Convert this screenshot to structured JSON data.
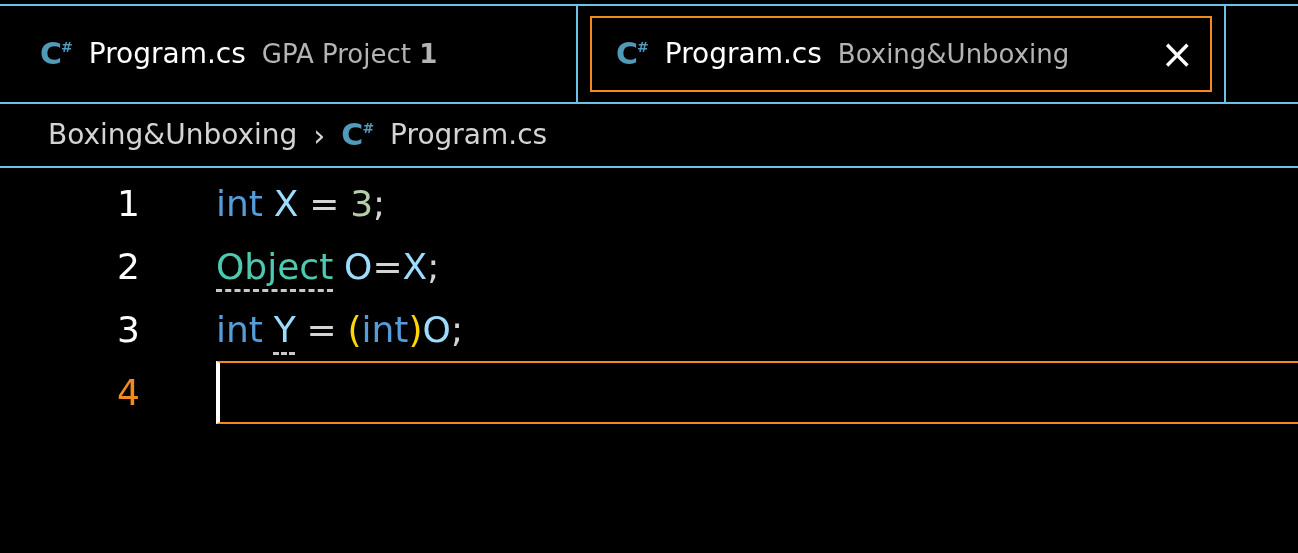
{
  "tabs": [
    {
      "icon": "C#",
      "file": "Program.cs",
      "project": "GPA Project **1**",
      "selected": false
    },
    {
      "icon": "C#",
      "file": "Program.cs",
      "project": "Boxing&Unboxing",
      "selected": true,
      "close": "×"
    }
  ],
  "breadcrumb": {
    "project": "Boxing&Unboxing",
    "separator": "›",
    "icon": "C#",
    "file": "Program.cs"
  },
  "lines": [
    {
      "number": "1",
      "current": false,
      "tokens": [
        {
          "text": "int",
          "kind": "keyword",
          "hint": false,
          "space_before": false
        },
        {
          "text": "X",
          "kind": "ident",
          "hint": false,
          "space_before": true
        },
        {
          "text": "=",
          "kind": "op",
          "hint": false,
          "space_before": true
        },
        {
          "text": "3",
          "kind": "number",
          "hint": false,
          "space_before": true
        },
        {
          "text": ";",
          "kind": "op",
          "hint": false,
          "space_before": false
        }
      ]
    },
    {
      "number": "2",
      "current": false,
      "tokens": [
        {
          "text": "Object",
          "kind": "type",
          "hint": true,
          "space_before": false
        },
        {
          "text": "O",
          "kind": "ident",
          "hint": false,
          "space_before": true
        },
        {
          "text": "=",
          "kind": "op",
          "hint": false,
          "space_before": false
        },
        {
          "text": "X",
          "kind": "ident",
          "hint": false,
          "space_before": false
        },
        {
          "text": ";",
          "kind": "op",
          "hint": false,
          "space_before": false
        }
      ]
    },
    {
      "number": "3",
      "current": false,
      "tokens": [
        {
          "text": "int",
          "kind": "keyword",
          "hint": false,
          "space_before": false
        },
        {
          "text": "Y",
          "kind": "ident",
          "hint": true,
          "space_before": true
        },
        {
          "text": "=",
          "kind": "op",
          "hint": false,
          "space_before": true
        },
        {
          "text": "(",
          "kind": "paren",
          "hint": false,
          "space_before": true
        },
        {
          "text": "int",
          "kind": "keyword",
          "hint": false,
          "space_before": false
        },
        {
          "text": ")",
          "kind": "paren",
          "hint": false,
          "space_before": false
        },
        {
          "text": "O",
          "kind": "ident",
          "hint": false,
          "space_before": false
        },
        {
          "text": ";",
          "kind": "op",
          "hint": false,
          "space_before": false
        }
      ]
    },
    {
      "number": "4",
      "current": true
    }
  ]
}
